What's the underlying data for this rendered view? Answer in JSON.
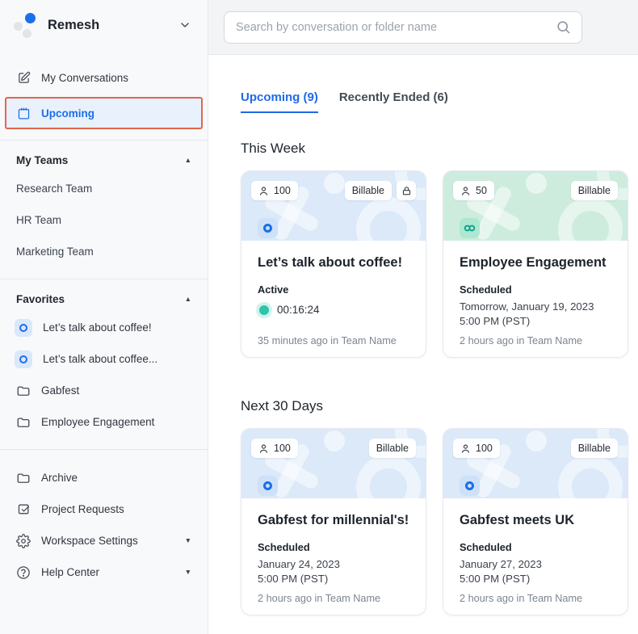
{
  "colors": {
    "accent_blue": "#1b6fe8",
    "active_teal": "#2cc5a9",
    "banner_blue": "#dbe9f8",
    "banner_green": "#cdecdd",
    "annotation_red": "#e4644d"
  },
  "sidebar": {
    "workspace_name": "Remesh",
    "nav": [
      {
        "label": "My Conversations"
      },
      {
        "label": "Upcoming"
      }
    ],
    "my_teams": {
      "header": "My Teams",
      "items": [
        {
          "label": "Research Team"
        },
        {
          "label": "HR Team"
        },
        {
          "label": "Marketing Team"
        }
      ]
    },
    "favorites": {
      "header": "Favorites",
      "items": [
        {
          "label": "Let’s talk about coffee!"
        },
        {
          "label": "Let’s talk about coffee..."
        },
        {
          "label": "Gabfest"
        },
        {
          "label": "Employee Engagement"
        }
      ]
    },
    "footer_nav": [
      {
        "label": "Archive"
      },
      {
        "label": "Project Requests"
      },
      {
        "label": "Workspace Settings"
      },
      {
        "label": "Help Center"
      }
    ]
  },
  "search": {
    "placeholder": "Search by conversation or folder name"
  },
  "tabs": [
    {
      "label": "Upcoming (9)"
    },
    {
      "label": "Recently Ended (6)"
    }
  ],
  "sections": [
    {
      "heading": "This Week",
      "cards": [
        {
          "participants": "100",
          "badge": "Billable",
          "title": "Let’s talk about coffee!",
          "status": "Active",
          "timer": "00:16:24",
          "footer": "35 minutes ago in Team Name"
        },
        {
          "participants": "50",
          "badge": "Billable",
          "title": "Employee Engagement",
          "status": "Scheduled",
          "date_line1": "Tomorrow, January 19, 2023",
          "date_line2": "5:00 PM (PST)",
          "footer": "2 hours ago in Team Name"
        }
      ]
    },
    {
      "heading": "Next 30 Days",
      "cards": [
        {
          "participants": "100",
          "badge": "Billable",
          "title": "Gabfest for millennial's!",
          "status": "Scheduled",
          "date_line1": "January 24, 2023",
          "date_line2": "5:00 PM (PST)",
          "footer": "2 hours ago in Team Name"
        },
        {
          "participants": "100",
          "badge": "Billable",
          "title": "Gabfest meets UK",
          "status": "Scheduled",
          "date_line1": "January 27, 2023",
          "date_line2": "5:00 PM (PST)",
          "footer": "2 hours ago in Team Name"
        }
      ]
    }
  ]
}
